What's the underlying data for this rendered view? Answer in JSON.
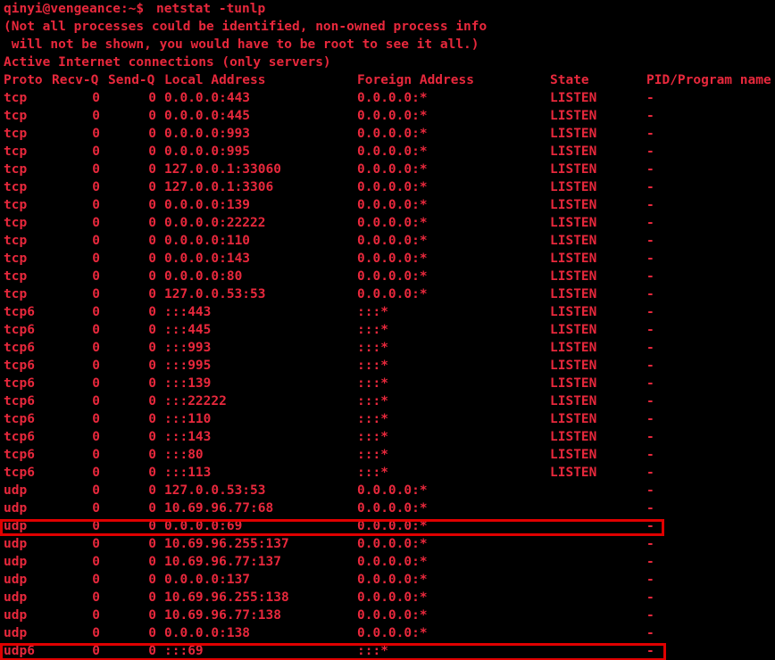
{
  "theme": {
    "background": "#000000",
    "text": "#e8283c",
    "highlight": "#e00000"
  },
  "prompt": {
    "user_host": "qinyi@vengeance:~$",
    "command": "netstat -tunlp"
  },
  "messages": [
    "(Not all processes could be identified, non-owned process info",
    " will not be shown, you would have to be root to see it all.)",
    "Active Internet connections (only servers)"
  ],
  "table": {
    "headers": {
      "proto": "Proto",
      "recvq": "Recv-Q",
      "sendq": "Send-Q",
      "local": "Local Address",
      "foreign": "Foreign Address",
      "state": "State",
      "pid": "PID/Program name"
    },
    "rows": [
      {
        "proto": "tcp",
        "recvq": "0",
        "sendq": "0",
        "local": "0.0.0.0:443",
        "foreign": "0.0.0.0:*",
        "state": "LISTEN",
        "pid": "-"
      },
      {
        "proto": "tcp",
        "recvq": "0",
        "sendq": "0",
        "local": "0.0.0.0:445",
        "foreign": "0.0.0.0:*",
        "state": "LISTEN",
        "pid": "-"
      },
      {
        "proto": "tcp",
        "recvq": "0",
        "sendq": "0",
        "local": "0.0.0.0:993",
        "foreign": "0.0.0.0:*",
        "state": "LISTEN",
        "pid": "-"
      },
      {
        "proto": "tcp",
        "recvq": "0",
        "sendq": "0",
        "local": "0.0.0.0:995",
        "foreign": "0.0.0.0:*",
        "state": "LISTEN",
        "pid": "-"
      },
      {
        "proto": "tcp",
        "recvq": "0",
        "sendq": "0",
        "local": "127.0.0.1:33060",
        "foreign": "0.0.0.0:*",
        "state": "LISTEN",
        "pid": "-"
      },
      {
        "proto": "tcp",
        "recvq": "0",
        "sendq": "0",
        "local": "127.0.0.1:3306",
        "foreign": "0.0.0.0:*",
        "state": "LISTEN",
        "pid": "-"
      },
      {
        "proto": "tcp",
        "recvq": "0",
        "sendq": "0",
        "local": "0.0.0.0:139",
        "foreign": "0.0.0.0:*",
        "state": "LISTEN",
        "pid": "-"
      },
      {
        "proto": "tcp",
        "recvq": "0",
        "sendq": "0",
        "local": "0.0.0.0:22222",
        "foreign": "0.0.0.0:*",
        "state": "LISTEN",
        "pid": "-"
      },
      {
        "proto": "tcp",
        "recvq": "0",
        "sendq": "0",
        "local": "0.0.0.0:110",
        "foreign": "0.0.0.0:*",
        "state": "LISTEN",
        "pid": "-"
      },
      {
        "proto": "tcp",
        "recvq": "0",
        "sendq": "0",
        "local": "0.0.0.0:143",
        "foreign": "0.0.0.0:*",
        "state": "LISTEN",
        "pid": "-"
      },
      {
        "proto": "tcp",
        "recvq": "0",
        "sendq": "0",
        "local": "0.0.0.0:80",
        "foreign": "0.0.0.0:*",
        "state": "LISTEN",
        "pid": "-"
      },
      {
        "proto": "tcp",
        "recvq": "0",
        "sendq": "0",
        "local": "127.0.0.53:53",
        "foreign": "0.0.0.0:*",
        "state": "LISTEN",
        "pid": "-"
      },
      {
        "proto": "tcp6",
        "recvq": "0",
        "sendq": "0",
        "local": ":::443",
        "foreign": ":::*",
        "state": "LISTEN",
        "pid": "-"
      },
      {
        "proto": "tcp6",
        "recvq": "0",
        "sendq": "0",
        "local": ":::445",
        "foreign": ":::*",
        "state": "LISTEN",
        "pid": "-"
      },
      {
        "proto": "tcp6",
        "recvq": "0",
        "sendq": "0",
        "local": ":::993",
        "foreign": ":::*",
        "state": "LISTEN",
        "pid": "-"
      },
      {
        "proto": "tcp6",
        "recvq": "0",
        "sendq": "0",
        "local": ":::995",
        "foreign": ":::*",
        "state": "LISTEN",
        "pid": "-"
      },
      {
        "proto": "tcp6",
        "recvq": "0",
        "sendq": "0",
        "local": ":::139",
        "foreign": ":::*",
        "state": "LISTEN",
        "pid": "-"
      },
      {
        "proto": "tcp6",
        "recvq": "0",
        "sendq": "0",
        "local": ":::22222",
        "foreign": ":::*",
        "state": "LISTEN",
        "pid": "-"
      },
      {
        "proto": "tcp6",
        "recvq": "0",
        "sendq": "0",
        "local": ":::110",
        "foreign": ":::*",
        "state": "LISTEN",
        "pid": "-"
      },
      {
        "proto": "tcp6",
        "recvq": "0",
        "sendq": "0",
        "local": ":::143",
        "foreign": ":::*",
        "state": "LISTEN",
        "pid": "-"
      },
      {
        "proto": "tcp6",
        "recvq": "0",
        "sendq": "0",
        "local": ":::80",
        "foreign": ":::*",
        "state": "LISTEN",
        "pid": "-"
      },
      {
        "proto": "tcp6",
        "recvq": "0",
        "sendq": "0",
        "local": ":::113",
        "foreign": ":::*",
        "state": "LISTEN",
        "pid": "-"
      },
      {
        "proto": "udp",
        "recvq": "0",
        "sendq": "0",
        "local": "127.0.0.53:53",
        "foreign": "0.0.0.0:*",
        "state": "",
        "pid": "-"
      },
      {
        "proto": "udp",
        "recvq": "0",
        "sendq": "0",
        "local": "10.69.96.77:68",
        "foreign": "0.0.0.0:*",
        "state": "",
        "pid": "-"
      },
      {
        "proto": "udp",
        "recvq": "0",
        "sendq": "0",
        "local": "0.0.0.0:69",
        "foreign": "0.0.0.0:*",
        "state": "",
        "pid": "-",
        "highlighted": true
      },
      {
        "proto": "udp",
        "recvq": "0",
        "sendq": "0",
        "local": "10.69.96.255:137",
        "foreign": "0.0.0.0:*",
        "state": "",
        "pid": "-"
      },
      {
        "proto": "udp",
        "recvq": "0",
        "sendq": "0",
        "local": "10.69.96.77:137",
        "foreign": "0.0.0.0:*",
        "state": "",
        "pid": "-"
      },
      {
        "proto": "udp",
        "recvq": "0",
        "sendq": "0",
        "local": "0.0.0.0:137",
        "foreign": "0.0.0.0:*",
        "state": "",
        "pid": "-"
      },
      {
        "proto": "udp",
        "recvq": "0",
        "sendq": "0",
        "local": "10.69.96.255:138",
        "foreign": "0.0.0.0:*",
        "state": "",
        "pid": "-"
      },
      {
        "proto": "udp",
        "recvq": "0",
        "sendq": "0",
        "local": "10.69.96.77:138",
        "foreign": "0.0.0.0:*",
        "state": "",
        "pid": "-"
      },
      {
        "proto": "udp",
        "recvq": "0",
        "sendq": "0",
        "local": "0.0.0.0:138",
        "foreign": "0.0.0.0:*",
        "state": "",
        "pid": "-"
      },
      {
        "proto": "udp6",
        "recvq": "0",
        "sendq": "0",
        "local": ":::69",
        "foreign": ":::*",
        "state": "",
        "pid": "-",
        "highlighted": true
      }
    ]
  }
}
